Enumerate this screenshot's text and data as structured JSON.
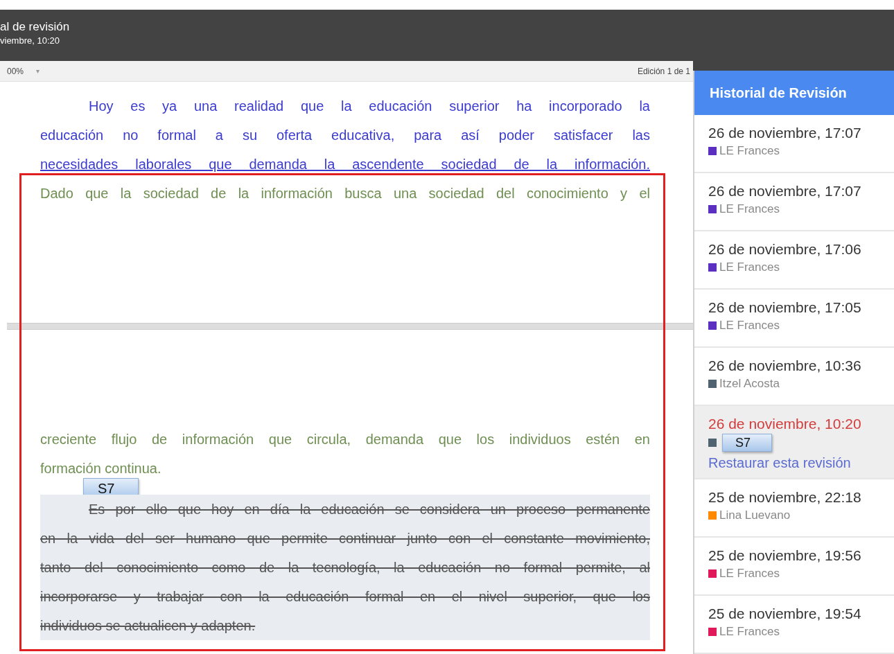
{
  "header": {
    "title": "al de revisión",
    "subtitle": "viembre, 10:20"
  },
  "toolbar": {
    "zoom": "00%",
    "zoom_caret": "▾",
    "edition": "Edición 1 de 1"
  },
  "document": {
    "pages": [
      {
        "paragraphs": [
          {
            "indent": true,
            "ends": false,
            "highlighted": false,
            "lines": [
              {
                "text": "Hoy es ya una realidad que la educación superior ha incorporado la",
                "color": "#3b3bd0",
                "underlined": false,
                "struck": false
              },
              {
                "text": "educación no formal  a su oferta educativa, para así poder satisfacer  las",
                "color": "#3b3bd0",
                "underlined": false,
                "struck": false
              },
              {
                "text": "necesidades laborales que demanda la ascendente sociedad de la información.",
                "color": "#3b3bd0",
                "underlined": true,
                "struck": false
              },
              {
                "text": "Dado que la sociedad de la información busca una sociedad del conocimiento y el",
                "color": "#6f8f52",
                "underlined": false,
                "struck": false
              }
            ]
          }
        ]
      },
      {
        "paragraphs": [
          {
            "indent": false,
            "ends": true,
            "highlighted": false,
            "tag": "S7",
            "lines": [
              {
                "text": "creciente flujo de información que circula,  demanda que los individuos estén en",
                "color": "#6f8f52",
                "underlined": false,
                "struck": false
              },
              {
                "text": "formación continua.",
                "color": "#6f8f52",
                "underlined": false,
                "struck": false
              }
            ]
          },
          {
            "indent": true,
            "ends": true,
            "highlighted": true,
            "lines": [
              {
                "text": "Es por ello que hoy en día la educación se considera un proceso permanente",
                "color": "#555555",
                "underlined": false,
                "struck": true
              },
              {
                "text": "en la vida del ser humano que permite continuar junto con el constante movimiento,",
                "color": "#555555",
                "underlined": false,
                "struck": true
              },
              {
                "text": "tanto del conocimiento como de la tecnología, la educación no formal permite, al",
                "color": "#555555",
                "underlined": false,
                "struck": true
              },
              {
                "text": "incorporarse y trabajar con la educación formal en el nivel superior, que los",
                "color": "#555555",
                "underlined": false,
                "struck": true
              },
              {
                "text": "individuos se actualicen y adapten.",
                "color": "#555555",
                "underlined": false,
                "struck": true
              }
            ]
          }
        ]
      }
    ]
  },
  "sidebar": {
    "title": "Historial de Revisión",
    "revisions": [
      {
        "date": "26 de noviembre, 17:07",
        "author": "LE Frances",
        "color": "#5b2fc0",
        "selected": false
      },
      {
        "date": "26 de noviembre, 17:07",
        "author": "LE Frances",
        "color": "#5b2fc0",
        "selected": false
      },
      {
        "date": "26 de noviembre, 17:06",
        "author": "LE Frances",
        "color": "#5b2fc0",
        "selected": false
      },
      {
        "date": "26 de noviembre, 17:05",
        "author": "LE Frances",
        "color": "#5b2fc0",
        "selected": false
      },
      {
        "date": "26 de noviembre, 10:36",
        "author": "Itzel Acosta",
        "color": "#4f6470",
        "selected": false
      },
      {
        "date": "26 de noviembre, 10:20",
        "color": "#4f6470",
        "selected": true,
        "tag": "S7",
        "restore_link": "Restaurar esta revisión"
      },
      {
        "date": "25 de noviembre, 22:18",
        "author": "Lina Luevano",
        "color": "#ff8a00",
        "selected": false
      },
      {
        "date": "25 de noviembre, 19:56",
        "author": "LE Frances",
        "color": "#e01a5a",
        "selected": false
      },
      {
        "date": "25 de noviembre, 19:54",
        "author": "LE Frances",
        "color": "#e01a5a",
        "selected": false
      }
    ]
  }
}
